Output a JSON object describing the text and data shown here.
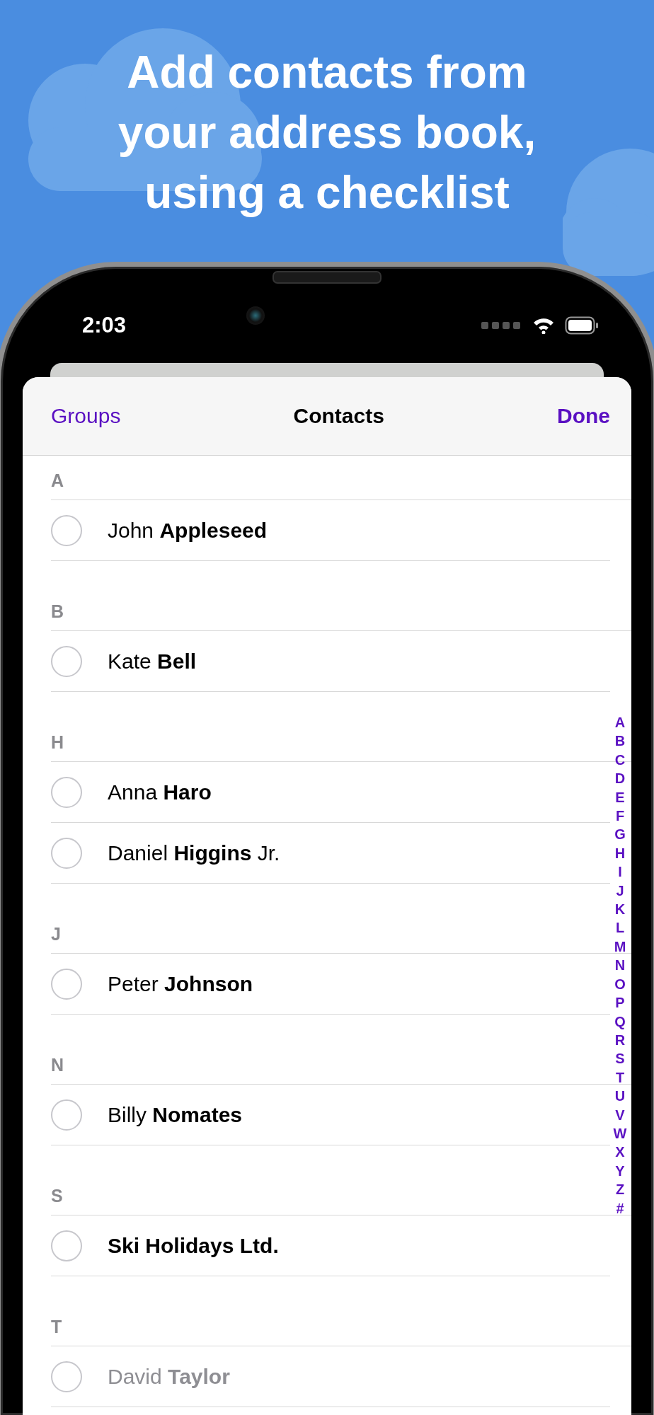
{
  "headline": [
    "Add contacts from",
    "your address book,",
    "using a checklist"
  ],
  "status_bar": {
    "time": "2:03"
  },
  "nav": {
    "left": "Groups",
    "title": "Contacts",
    "right": "Done"
  },
  "sections": [
    {
      "letter": "A",
      "contacts": [
        {
          "name": "John **Appleseed**",
          "kind": "person",
          "checked": false,
          "dimmed": false
        }
      ]
    },
    {
      "letter": "B",
      "contacts": [
        {
          "name": "Kate **Bell**",
          "kind": "person",
          "checked": false,
          "dimmed": false
        }
      ]
    },
    {
      "letter": "H",
      "contacts": [
        {
          "name": "Anna **Haro**",
          "kind": "person",
          "checked": false,
          "dimmed": false
        },
        {
          "name": "Daniel **Higgins** Jr.",
          "kind": "person",
          "checked": false,
          "dimmed": false
        }
      ]
    },
    {
      "letter": "J",
      "contacts": [
        {
          "name": "Peter **Johnson**",
          "kind": "person",
          "checked": false,
          "dimmed": false
        }
      ]
    },
    {
      "letter": "N",
      "contacts": [
        {
          "name": "Billy **Nomates**",
          "kind": "person",
          "checked": false,
          "dimmed": false
        }
      ]
    },
    {
      "letter": "S",
      "contacts": [
        {
          "name": "Ski Holidays Ltd.",
          "kind": "company",
          "checked": false,
          "dimmed": false
        }
      ]
    },
    {
      "letter": "T",
      "contacts": [
        {
          "name": "David **Taylor**",
          "kind": "person",
          "checked": false,
          "dimmed": true
        }
      ]
    }
  ],
  "index": [
    "A",
    "B",
    "C",
    "D",
    "E",
    "F",
    "G",
    "H",
    "I",
    "J",
    "K",
    "L",
    "M",
    "N",
    "O",
    "P",
    "Q",
    "R",
    "S",
    "T",
    "U",
    "V",
    "W",
    "X",
    "Y",
    "Z",
    "#"
  ]
}
